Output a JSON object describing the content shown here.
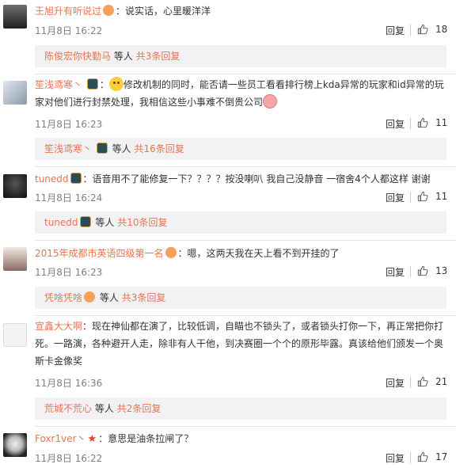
{
  "comments": [
    {
      "user": "王旭升有听说过",
      "text": "：说实话，心里暖洋洋",
      "time": "11月8日 16:22",
      "reply": "回复",
      "likes": "18",
      "sub": {
        "name": "陈俊宏你快勤马",
        "mid": "等人",
        "count": "共3条回复"
      }
    },
    {
      "user": "笙浅鸢寒丶",
      "text_a": "修改机制的同时，能否请一些员工看看排行榜上kda异常的玩家和id异常的玩",
      "text_b": "家对他们进行封禁处理，我相信这些小事难不倒贵公司",
      "time": "11月8日 16:23",
      "reply": "回复",
      "likes": "11",
      "sub": {
        "name": "笙浅鸢寒丶",
        "mid": "等人",
        "count": "共16条回复"
      }
    },
    {
      "user": "tunedd",
      "text": "：语音用不了能修复一下？？？？按没喇叭 我自己没静音 一宿舍4个人都这样 谢谢",
      "time": "11月8日 16:24",
      "reply": "回复",
      "likes": "11",
      "sub": {
        "name": "tunedd",
        "mid": "等人",
        "count": "共10条回复"
      }
    },
    {
      "user": "2015年成都市英语四级第一名",
      "text": "：嗯，这两天我在天上看不到开挂的了",
      "time": "11月8日 16:23",
      "reply": "回复",
      "likes": "13",
      "sub": {
        "name": "凭啥凭啥",
        "mid": "等人",
        "count": "共3条回复"
      }
    },
    {
      "user": "宣鑫大大啊",
      "text_a": "：现在神仙都在演了，比较低调，自瞄也不锁头了，或者锁头打你一下，再正常把你打",
      "text_b": "死。一路演，各种避开人走，除非有人干他，到决赛圈一个个的原形毕露。真该给他们颁发一个奥",
      "text_c": "斯卡金像奖",
      "time": "11月8日 16:36",
      "reply": "回复",
      "likes": "21",
      "sub": {
        "name": "荒城不荒心",
        "mid": "等人",
        "count": "共2条回复"
      }
    },
    {
      "user": "Foxr1ver丶",
      "text": "：意思是油条拉闸了？",
      "time": "11月8日 16:22",
      "reply": "回复",
      "likes": "17"
    }
  ],
  "icons": {
    "like": "thumbs-up-icon",
    "badge": "lol-badge-icon"
  },
  "colors": {
    "username": "#eb7350",
    "sub_bg": "#f2f2f5",
    "meta": "#808080"
  }
}
